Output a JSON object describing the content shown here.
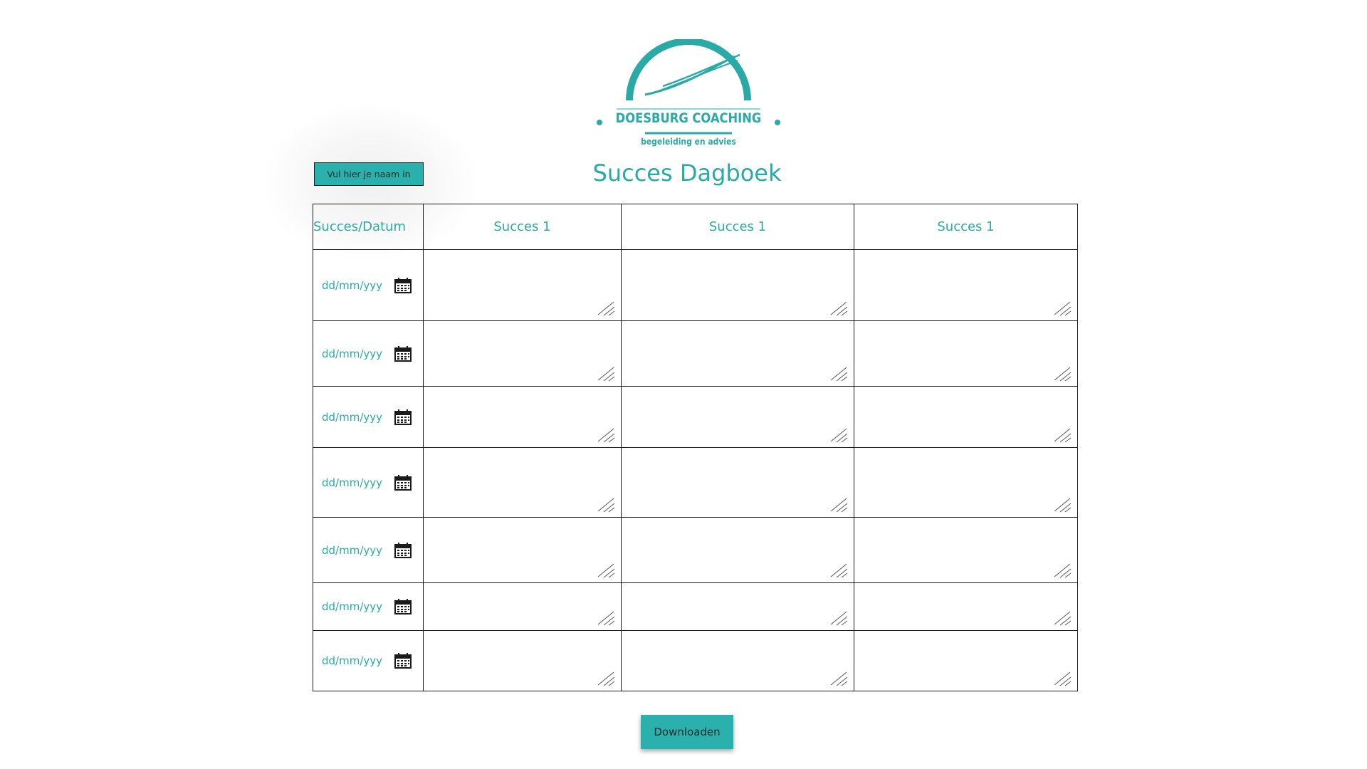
{
  "brand": {
    "name": "DOESBURG COACHING",
    "tagline": "begeleiding en advies",
    "color": "#29aaa6"
  },
  "name_field": {
    "placeholder": "Vul hier je naam in"
  },
  "page_title": "Succes Dagboek",
  "table": {
    "headers": [
      "Succes/Datum",
      "Succes 1",
      "Succes 1",
      "Succes 1"
    ],
    "rows": [
      {
        "date_placeholder": "dd/mm/yyy"
      },
      {
        "date_placeholder": "dd/mm/yyy"
      },
      {
        "date_placeholder": "dd/mm/yyy"
      },
      {
        "date_placeholder": "dd/mm/yyy"
      },
      {
        "date_placeholder": "dd/mm/yyy"
      },
      {
        "date_placeholder": "dd/mm/yyy"
      },
      {
        "date_placeholder": "dd/mm/yyy"
      }
    ]
  },
  "actions": {
    "download_label": "Downloaden"
  },
  "icons": {
    "calendar": "calendar-icon",
    "resize": "resize-grip-icon"
  }
}
